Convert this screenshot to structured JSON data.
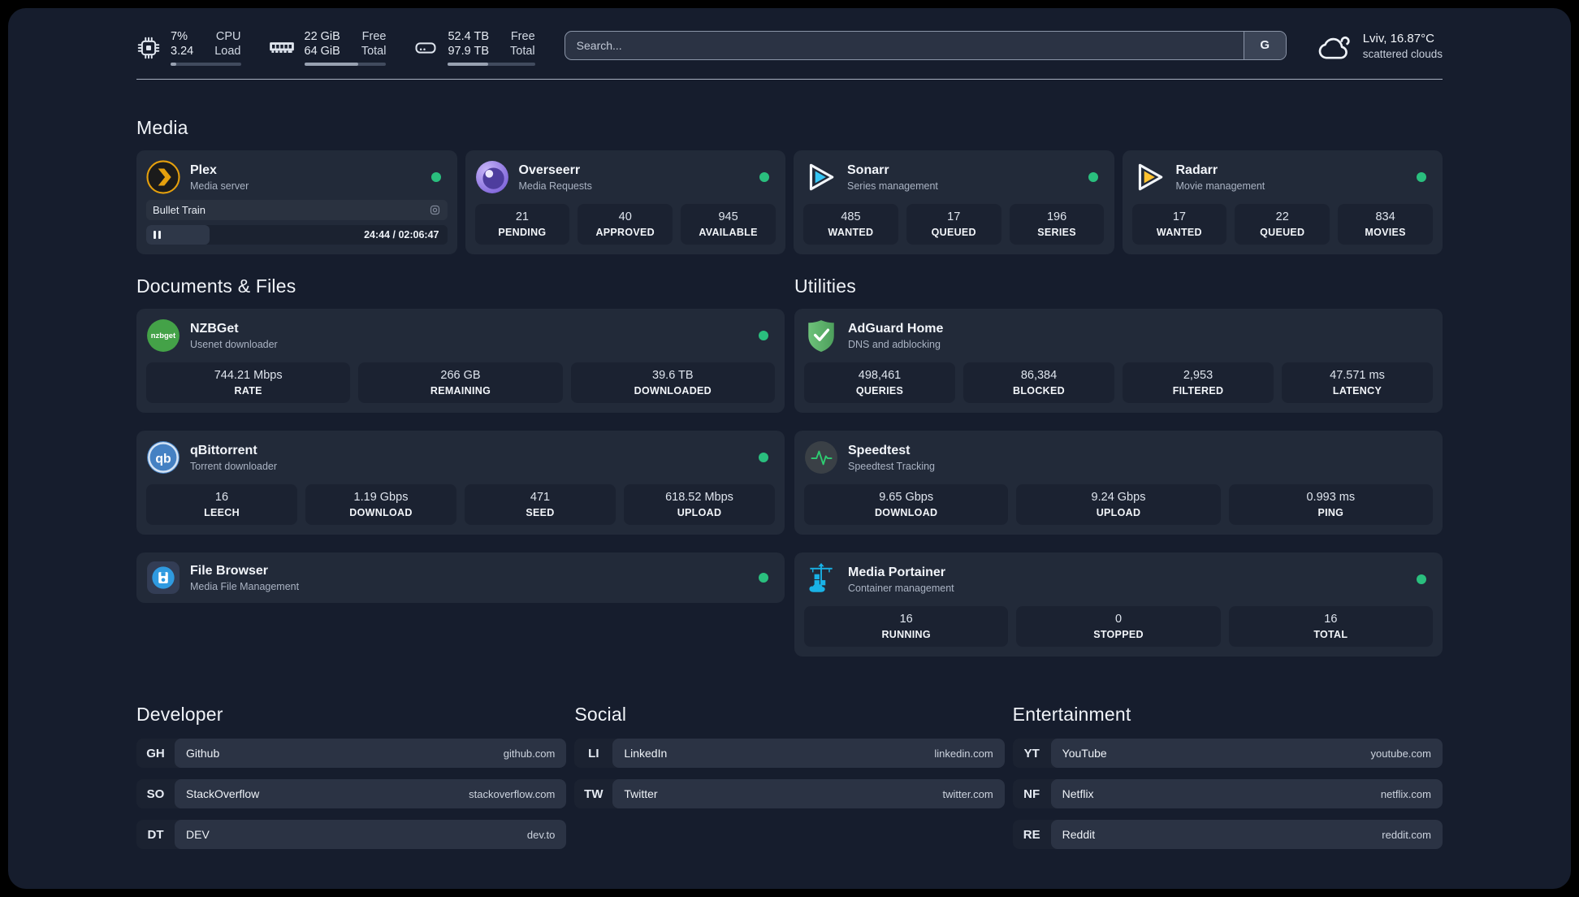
{
  "colors": {
    "status_green": "#2abf7e",
    "accent_plex": "#e5a00d",
    "accent_sonarr": "#35c5f4",
    "accent_radarr": "#ffc230",
    "accent_portainer": "#19b2e6"
  },
  "header": {
    "stats": [
      {
        "icon": "cpu-icon",
        "value_top": "7%",
        "value_bottom": "3.24",
        "label_top": "CPU",
        "label_bottom": "Load",
        "progress": "8%"
      },
      {
        "icon": "ram-icon",
        "value_top": "22 GiB",
        "value_bottom": "64 GiB",
        "label_top": "Free",
        "label_bottom": "Total",
        "progress": "66%"
      },
      {
        "icon": "disk-icon",
        "value_top": "52.4 TB",
        "value_bottom": "97.9 TB",
        "label_top": "Free",
        "label_bottom": "Total",
        "progress": "46%"
      }
    ],
    "search": {
      "placeholder": "Search...",
      "engine_button": "G"
    },
    "weather": {
      "location": "Lviv, 16.87°C",
      "condition": "scattered clouds"
    }
  },
  "media": {
    "heading": "Media",
    "plex": {
      "name": "Plex",
      "description": "Media server",
      "now_playing": "Bullet Train",
      "time": "24:44 / 02:06:47",
      "progress": "21%"
    },
    "overseerr": {
      "name": "Overseerr",
      "description": "Media Requests",
      "stats": [
        {
          "value": "21",
          "label": "PENDING"
        },
        {
          "value": "40",
          "label": "APPROVED"
        },
        {
          "value": "945",
          "label": "AVAILABLE"
        }
      ]
    },
    "sonarr": {
      "name": "Sonarr",
      "description": "Series management",
      "stats": [
        {
          "value": "485",
          "label": "WANTED"
        },
        {
          "value": "17",
          "label": "QUEUED"
        },
        {
          "value": "196",
          "label": "SERIES"
        }
      ]
    },
    "radarr": {
      "name": "Radarr",
      "description": "Movie management",
      "stats": [
        {
          "value": "17",
          "label": "WANTED"
        },
        {
          "value": "22",
          "label": "QUEUED"
        },
        {
          "value": "834",
          "label": "MOVIES"
        }
      ]
    }
  },
  "documents": {
    "heading": "Documents & Files",
    "nzbget": {
      "name": "NZBGet",
      "description": "Usenet downloader",
      "stats": [
        {
          "value": "744.21 Mbps",
          "label": "RATE"
        },
        {
          "value": "266 GB",
          "label": "REMAINING"
        },
        {
          "value": "39.6 TB",
          "label": "DOWNLOADED"
        }
      ]
    },
    "qbittorrent": {
      "name": "qBittorrent",
      "description": "Torrent downloader",
      "stats": [
        {
          "value": "16",
          "label": "LEECH"
        },
        {
          "value": "1.19 Gbps",
          "label": "DOWNLOAD"
        },
        {
          "value": "471",
          "label": "SEED"
        },
        {
          "value": "618.52 Mbps",
          "label": "UPLOAD"
        }
      ]
    },
    "filebrowser": {
      "name": "File Browser",
      "description": "Media File Management"
    }
  },
  "utilities": {
    "heading": "Utilities",
    "adguard": {
      "name": "AdGuard Home",
      "description": "DNS and adblocking",
      "stats": [
        {
          "value": "498,461",
          "label": "QUERIES"
        },
        {
          "value": "86,384",
          "label": "BLOCKED"
        },
        {
          "value": "2,953",
          "label": "FILTERED"
        },
        {
          "value": "47.571 ms",
          "label": "LATENCY"
        }
      ]
    },
    "speedtest": {
      "name": "Speedtest",
      "description": "Speedtest Tracking",
      "stats": [
        {
          "value": "9.65 Gbps",
          "label": "DOWNLOAD"
        },
        {
          "value": "9.24 Gbps",
          "label": "UPLOAD"
        },
        {
          "value": "0.993 ms",
          "label": "PING"
        }
      ]
    },
    "portainer": {
      "name": "Media Portainer",
      "description": "Container management",
      "stats": [
        {
          "value": "16",
          "label": "RUNNING"
        },
        {
          "value": "0",
          "label": "STOPPED"
        },
        {
          "value": "16",
          "label": "TOTAL"
        }
      ]
    }
  },
  "links": {
    "developer": {
      "heading": "Developer",
      "items": [
        {
          "abbr": "GH",
          "name": "Github",
          "url": "github.com"
        },
        {
          "abbr": "SO",
          "name": "StackOverflow",
          "url": "stackoverflow.com"
        },
        {
          "abbr": "DT",
          "name": "DEV",
          "url": "dev.to"
        }
      ]
    },
    "social": {
      "heading": "Social",
      "items": [
        {
          "abbr": "LI",
          "name": "LinkedIn",
          "url": "linkedin.com"
        },
        {
          "abbr": "TW",
          "name": "Twitter",
          "url": "twitter.com"
        }
      ]
    },
    "entertainment": {
      "heading": "Entertainment",
      "items": [
        {
          "abbr": "YT",
          "name": "YouTube",
          "url": "youtube.com"
        },
        {
          "abbr": "NF",
          "name": "Netflix",
          "url": "netflix.com"
        },
        {
          "abbr": "RE",
          "name": "Reddit",
          "url": "reddit.com"
        }
      ]
    }
  }
}
